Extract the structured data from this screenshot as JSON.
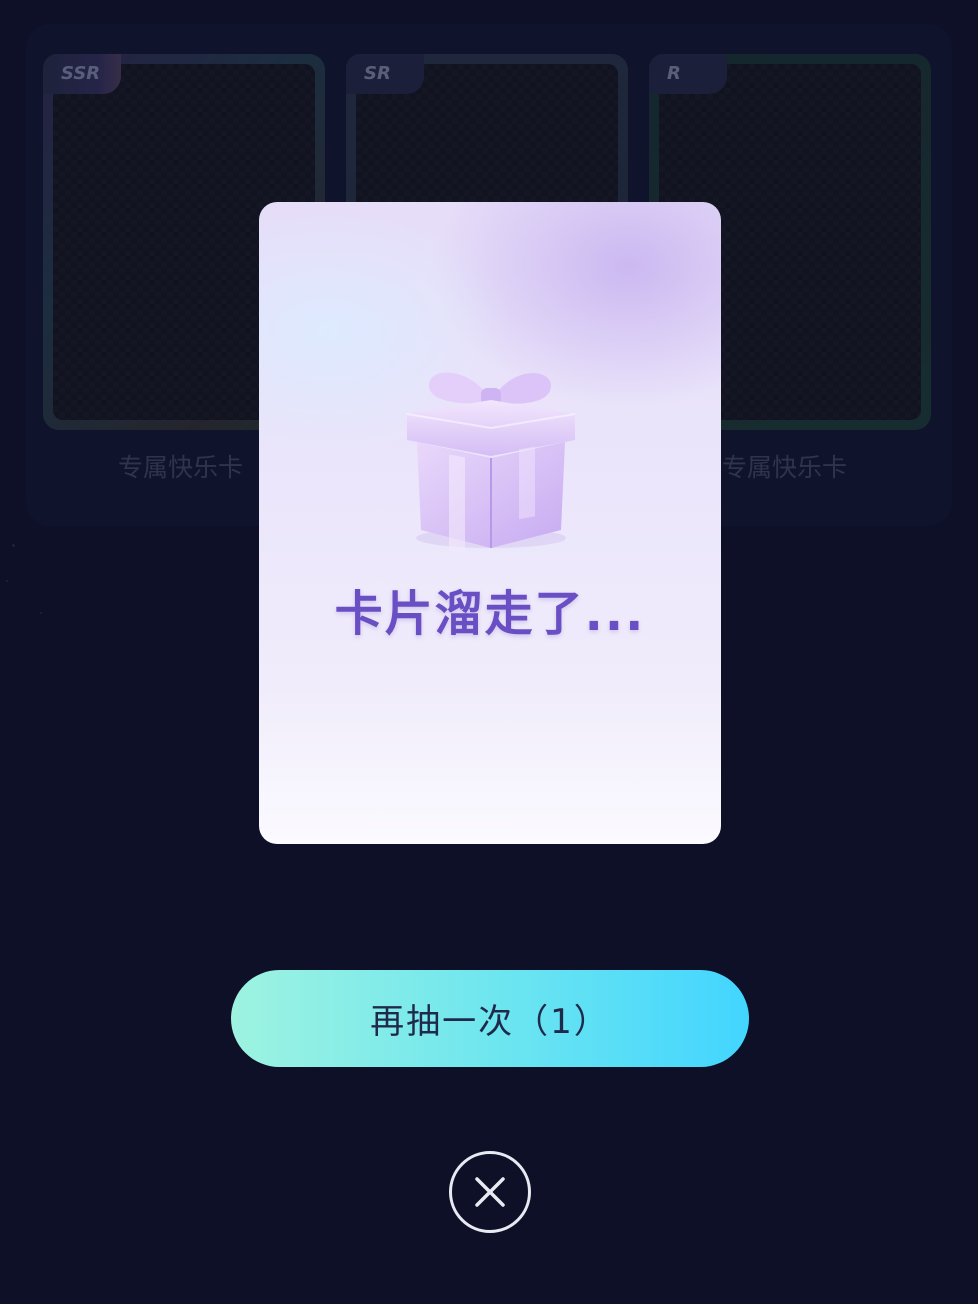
{
  "cards": [
    {
      "rarity": "SSR",
      "label": "专属快乐卡"
    },
    {
      "rarity": "SR",
      "label": ""
    },
    {
      "rarity": "R",
      "label": "专属快乐卡"
    }
  ],
  "popup": {
    "message": "卡片溜走了..."
  },
  "retry_button": {
    "label": "再抽一次（1）"
  },
  "icons": {
    "gift": "gift-icon",
    "close": "close-icon"
  },
  "colors": {
    "background": "#10142e",
    "button_gradient_start": "#9ef3e0",
    "button_gradient_end": "#42d5ff",
    "popup_text": "#6a4fc4"
  }
}
